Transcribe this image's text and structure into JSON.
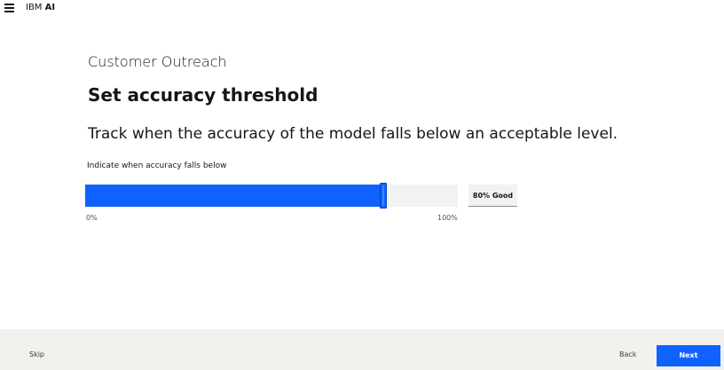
{
  "header": {
    "brand_prefix": "IBM",
    "brand_name": "AI"
  },
  "page": {
    "subtitle": "Customer Outreach",
    "title": "Set accuracy threshold",
    "description": "Track when the accuracy of the model falls below an acceptable level."
  },
  "slider": {
    "label": "Indicate when accuracy falls below",
    "min_label": "0%",
    "max_label": "100%",
    "value_percent": 80,
    "value_text": "80% Good"
  },
  "footer": {
    "skip_label": "Skip",
    "back_label": "Back",
    "next_label": "Next"
  },
  "colors": {
    "accent": "#0f62fe",
    "footer_bg": "#f2f1ee",
    "track_bg": "#f2f2f2"
  }
}
